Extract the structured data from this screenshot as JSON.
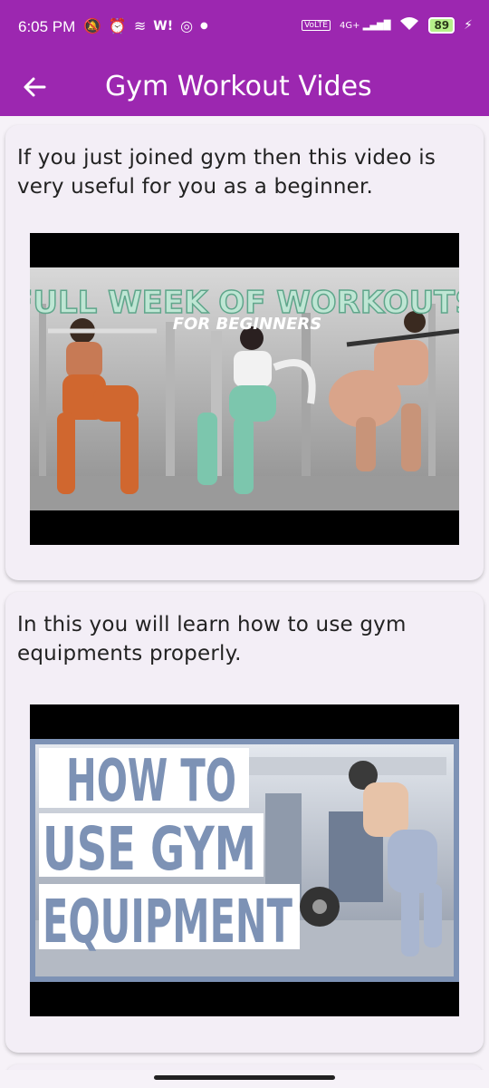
{
  "status_bar": {
    "time": "6:05 PM",
    "network_label": "4G+",
    "battery_level": "89"
  },
  "app_bar": {
    "title": "Gym Workout Vides",
    "back_icon": "arrow-left-icon"
  },
  "videos": [
    {
      "description": "If you just joined gym then this video is very useful for you as a beginner.",
      "thumbnail_title": "FULL WEEK OF WORKOUTS",
      "thumbnail_subtitle": "FOR BEGINNERS"
    },
    {
      "description": "In this you will learn how to use gym equipments properly.",
      "thumbnail_lines": [
        "HOW TO",
        "USE GYM",
        "EQUIPMENT"
      ]
    }
  ],
  "colors": {
    "primary": "#9c27b0",
    "background": "#f6f2f8",
    "card": "#f3eef6"
  }
}
